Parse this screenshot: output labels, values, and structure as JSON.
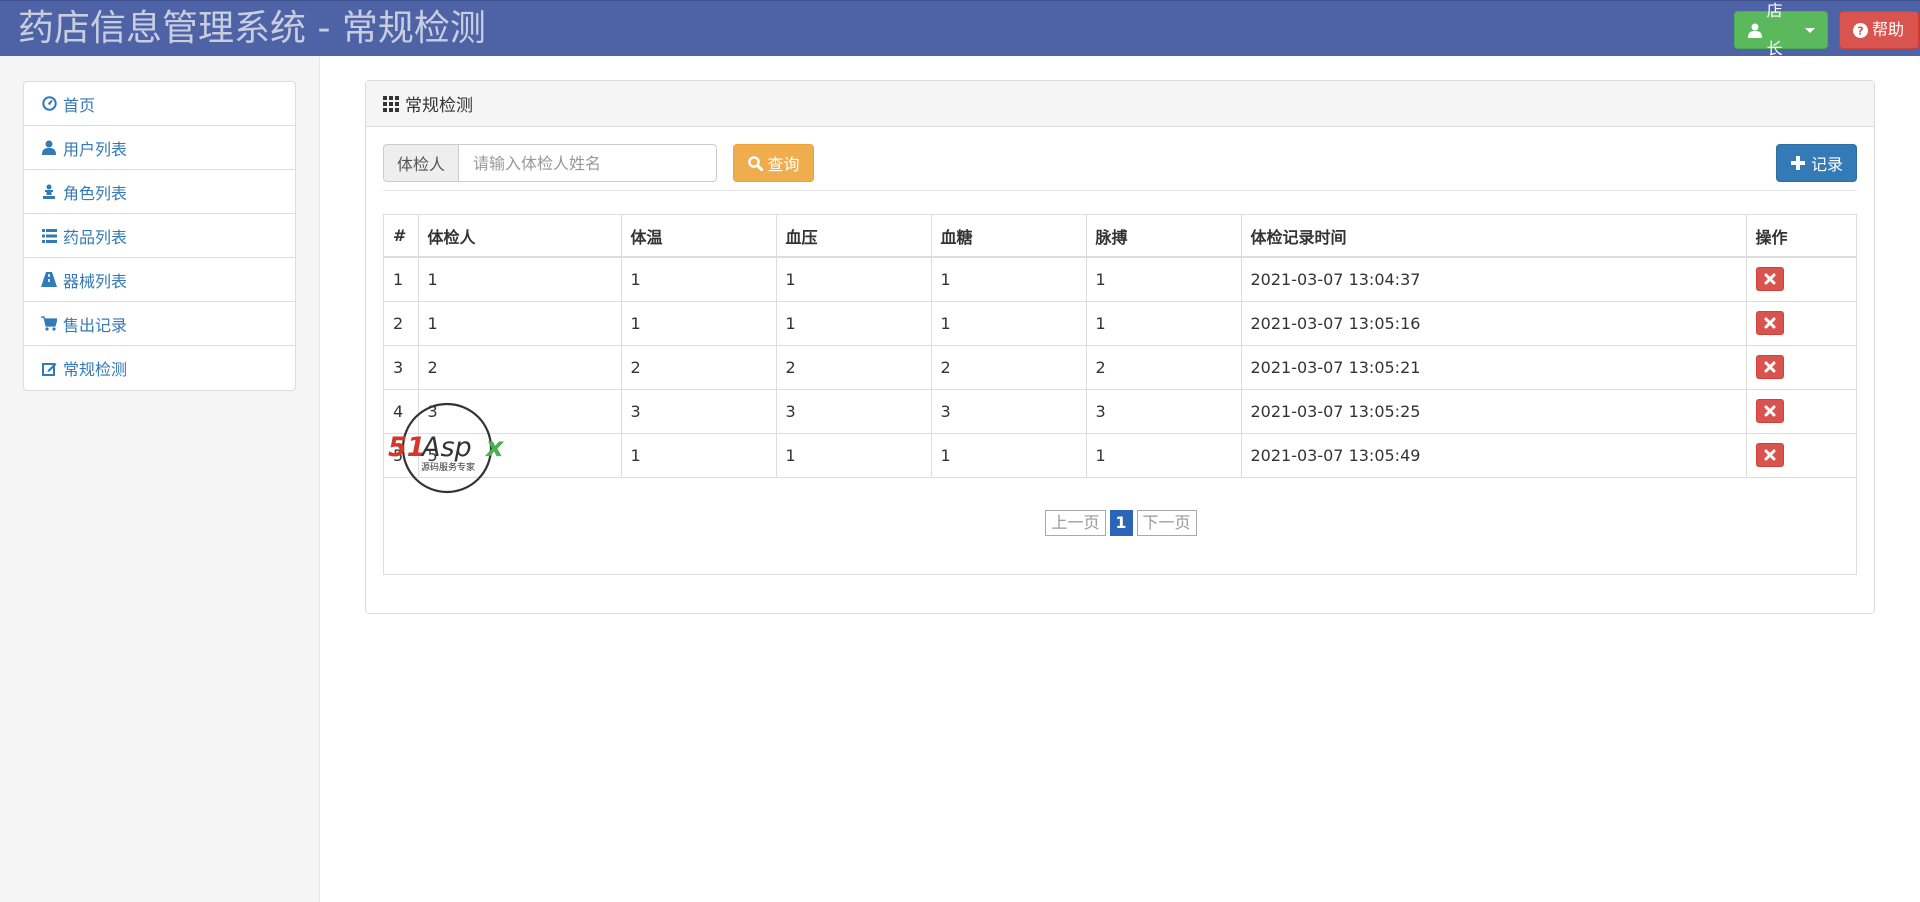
{
  "header": {
    "title": "药店信息管理系统 - 常规检测",
    "user_label": "店长",
    "help_label": "帮助"
  },
  "sidebar": {
    "items": [
      {
        "label": "首页",
        "icon": "dashboard-icon"
      },
      {
        "label": "用户列表",
        "icon": "user-icon"
      },
      {
        "label": "角色列表",
        "icon": "chess-icon"
      },
      {
        "label": "药品列表",
        "icon": "list-icon"
      },
      {
        "label": "器械列表",
        "icon": "road-icon"
      },
      {
        "label": "售出记录",
        "icon": "cart-icon"
      },
      {
        "label": "常规检测",
        "icon": "edit-icon"
      }
    ]
  },
  "panel": {
    "title": "常规检测",
    "search_addon": "体检人",
    "search_placeholder": "请输入体检人姓名",
    "search_value": "",
    "query_label": "查询",
    "record_label": "记录"
  },
  "table": {
    "headers": [
      "#",
      "体检人",
      "体温",
      "血压",
      "血糖",
      "脉搏",
      "体检记录时间",
      "操作"
    ],
    "rows": [
      [
        "1",
        "1",
        "1",
        "1",
        "1",
        "1",
        "2021-03-07 13:04:37"
      ],
      [
        "2",
        "1",
        "1",
        "1",
        "1",
        "1",
        "2021-03-07 13:05:16"
      ],
      [
        "3",
        "2",
        "2",
        "2",
        "2",
        "2",
        "2021-03-07 13:05:21"
      ],
      [
        "4",
        "3",
        "3",
        "3",
        "3",
        "3",
        "2021-03-07 13:05:25"
      ],
      [
        "5",
        "5",
        "1",
        "1",
        "1",
        "1",
        "2021-03-07 13:05:49"
      ]
    ]
  },
  "pagination": {
    "prev": "上一页",
    "current": "1",
    "next": "下一页"
  },
  "watermark": {
    "brand": "51Aspx",
    "tagline": "源码服务专家"
  },
  "colors": {
    "header_bg": "#4e62a6",
    "success": "#5cb85c",
    "danger": "#d9534f",
    "warning": "#f0ad4e",
    "primary": "#337ab7",
    "link": "#337ab7"
  }
}
